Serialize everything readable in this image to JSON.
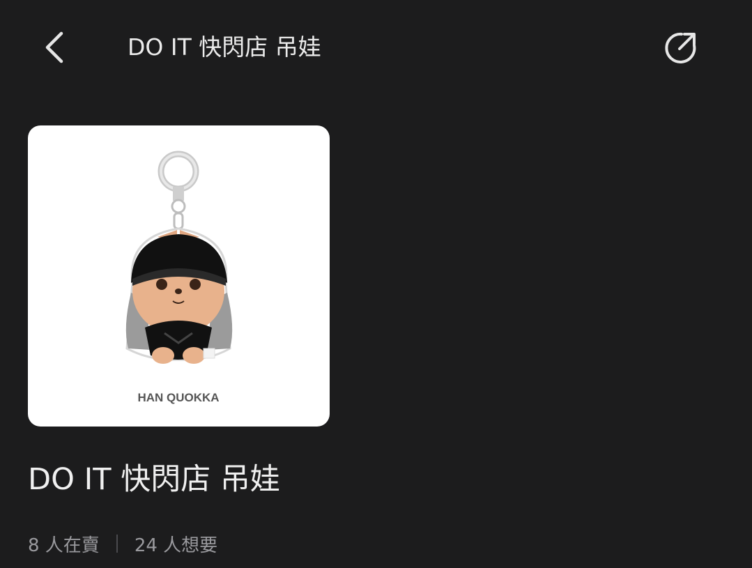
{
  "header": {
    "title": "DO IT 快閃店 吊娃",
    "back_icon": "chevron-left-icon",
    "share_icon": "share-icon"
  },
  "product": {
    "image_caption": "HAN QUOKKA",
    "title": "DO IT 快閃店 吊娃",
    "sellers": "8 人在賣",
    "wants": "24 人想要"
  },
  "colors": {
    "background": "#1c1c1d",
    "text_primary": "#ececec",
    "text_secondary": "#9a9a9e",
    "card_background": "#ffffff"
  }
}
